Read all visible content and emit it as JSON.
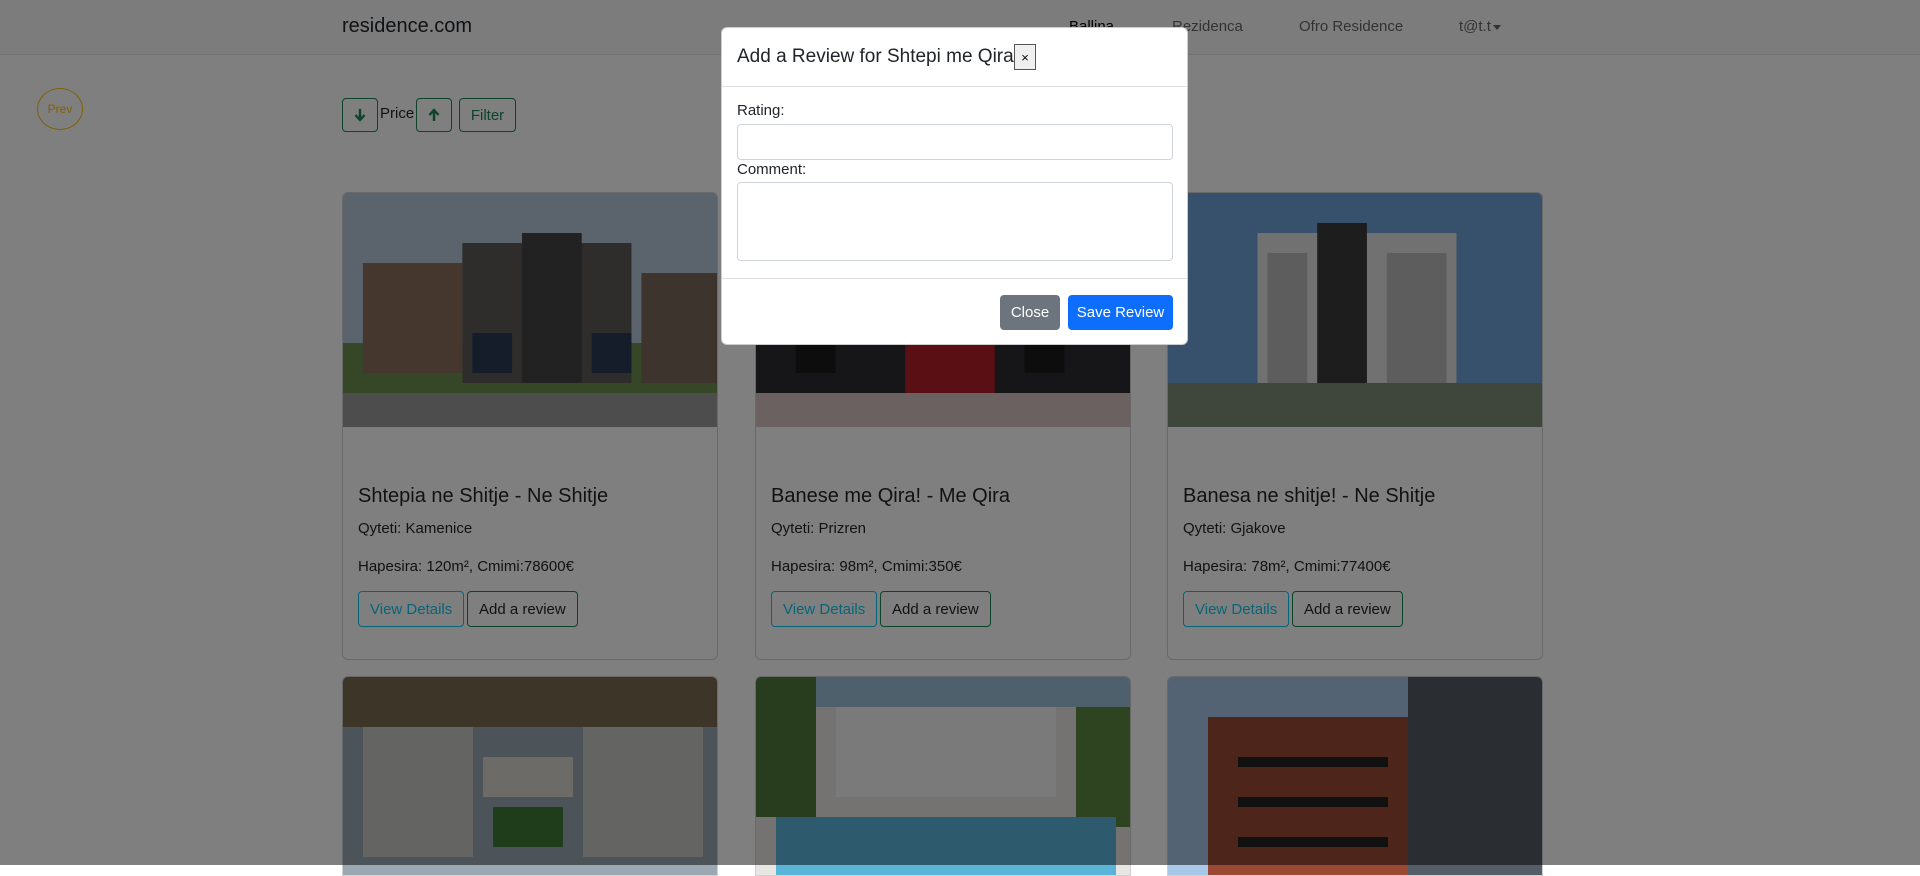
{
  "navbar": {
    "brand": "residence.com",
    "links": [
      "Ballina",
      "Rezidenca",
      "Ofro Residence"
    ],
    "user": "t@t.t"
  },
  "pagination": {
    "prev_label": "Prev"
  },
  "filters": {
    "price_label": "Price",
    "filter_label": "Filter"
  },
  "listings": [
    {
      "title": "Shtepia ne Shitje - Ne Shitje",
      "city": "Qyteti: Kamenice",
      "specs": "Hapesira: 120m², Cmimi:78600€"
    },
    {
      "title": "Banese me Qira! - Me Qira",
      "city": "Qyteti: Prizren",
      "specs": "Hapesira: 98m², Cmimi:350€"
    },
    {
      "title": "Banesa ne shitje! - Ne Shitje",
      "city": "Qyteti: Gjakove",
      "specs": "Hapesira: 78m², Cmimi:77400€"
    }
  ],
  "card_buttons": {
    "details": "View Details",
    "review": "Add a review"
  },
  "modal": {
    "title": "Add a Review for Shtepi me Qira",
    "close_x": "×",
    "rating_label": "Rating:",
    "rating_value": "",
    "comment_label": "Comment:",
    "comment_value": "",
    "close_label": "Close",
    "save_label": "Save Review"
  },
  "colors": {
    "primary": "#0d6efd",
    "secondary": "#6c757d",
    "success": "#198754",
    "info": "#0dcaf0",
    "warning": "#ffc107"
  }
}
